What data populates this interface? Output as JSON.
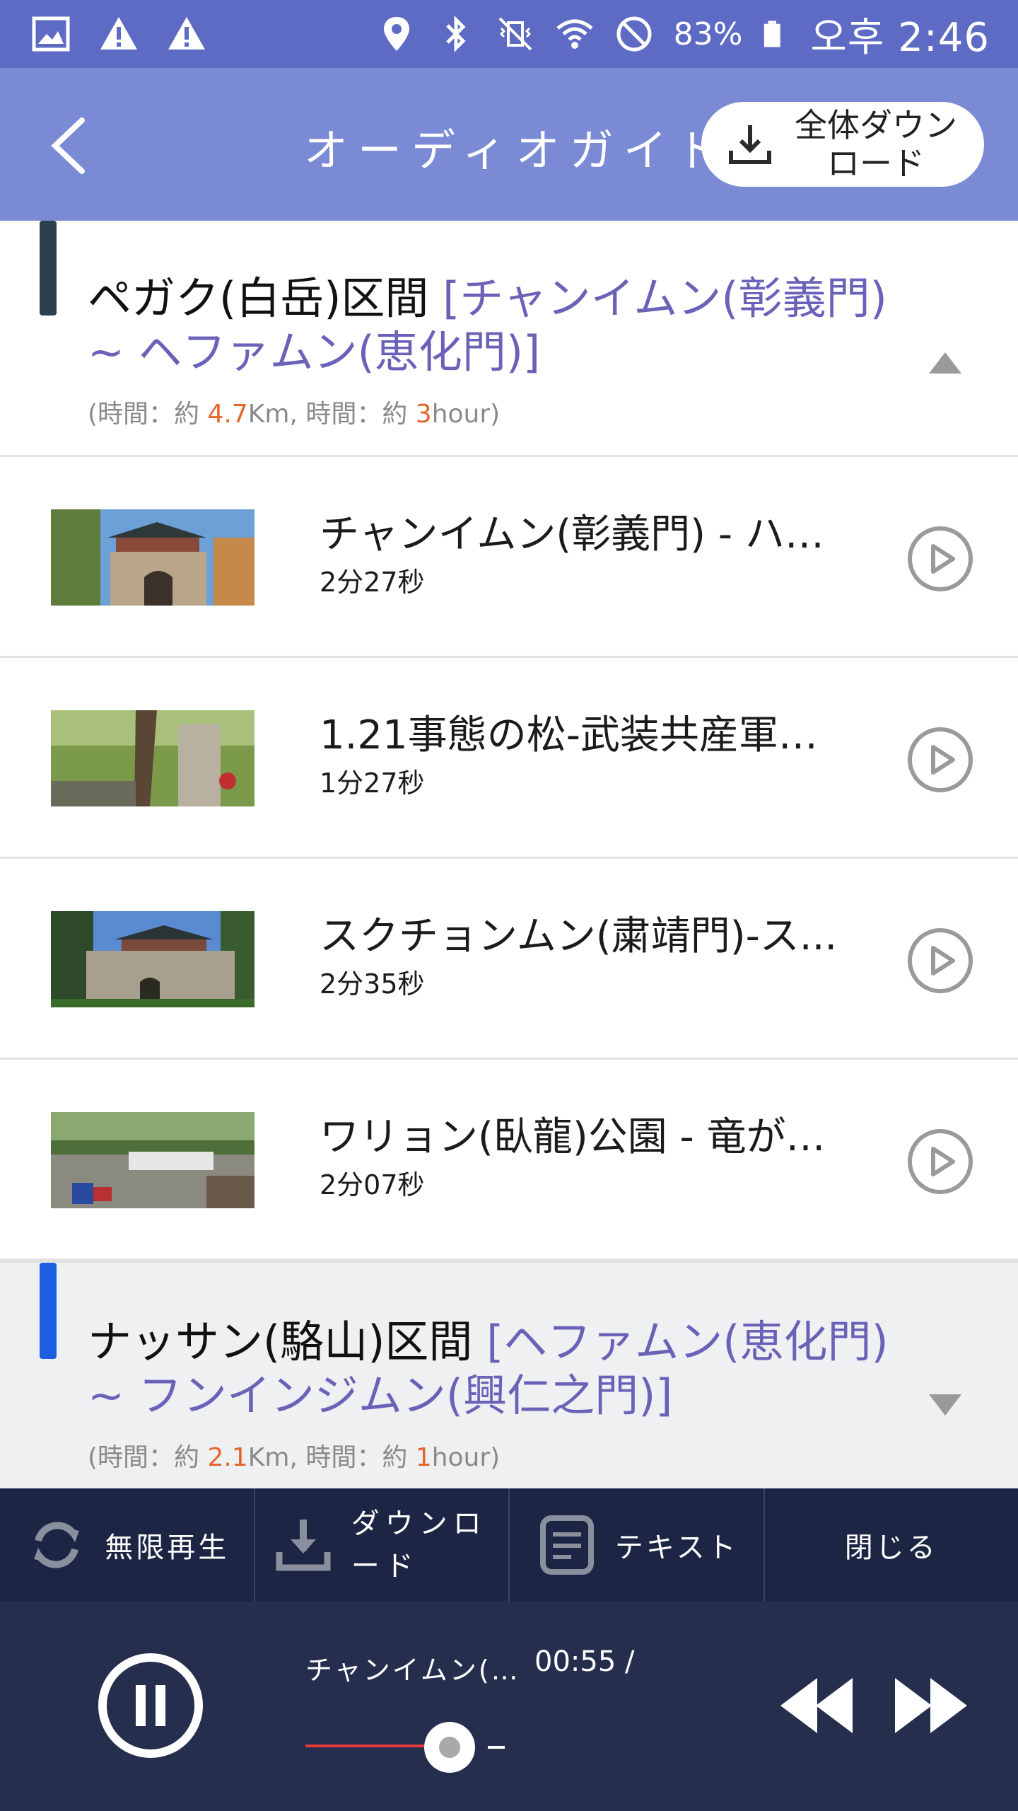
{
  "status_bar": {
    "icons": [
      "gallery-icon",
      "warning-icon",
      "warning-icon",
      "location-icon",
      "bluetooth-icon",
      "vibrate-off-icon",
      "wifi-icon",
      "no-disturb-icon",
      "battery-icon"
    ],
    "battery": "83%",
    "time": "오후 2:46"
  },
  "app_bar": {
    "title": "オーディオガイド",
    "download_all_label": "全体ダウンロード"
  },
  "sections": [
    {
      "name": "ペガク(白岳)区間 ",
      "range": "[チャンイムン(彰義門) ~ ヘファムン(恵化門)]",
      "meta_prefix": "(時間：約 ",
      "distance": "4.7",
      "meta_mid": "Km, 時間：約 ",
      "hours": "3",
      "meta_suffix": "hour)",
      "expanded": true
    },
    {
      "name": "ナッサン(駱山)区間 ",
      "range": "[ヘファムン(恵化門) ~ フンインジムン(興仁之門)]",
      "meta_prefix": "(時間：約 ",
      "distance": "2.1",
      "meta_mid": "Km, 時間：約 ",
      "hours": "1",
      "meta_suffix": "hour)",
      "expanded": false
    }
  ],
  "tracks": [
    {
      "title": "チャンイムン(彰義門) - ハニ...",
      "duration": "2分27秒"
    },
    {
      "title": "1.21事態の松-武装共産軍の...",
      "duration": "1分27秒"
    },
    {
      "title": "スクチョンムン(粛靖門)-ス...",
      "duration": "2分35秒"
    },
    {
      "title": "ワリョン(臥龍)公園 - 竜が横...",
      "duration": "2分07秒"
    }
  ],
  "actions": {
    "repeat": "無限再生",
    "download": "ダウンロード",
    "text": "テキスト",
    "close": "閉じる"
  },
  "player": {
    "now_playing": "チャンイムン(…",
    "time": "00:55 /",
    "progress": 0.6,
    "played_color": "#e63a3a"
  },
  "colors": {
    "status_bar": "#5d6bc5",
    "app_bar": "#7b8ad5",
    "accent_range": "#6a62b8",
    "meta_number": "#e5662a",
    "action_bar": "#1d2544",
    "player": "#262e4e"
  }
}
